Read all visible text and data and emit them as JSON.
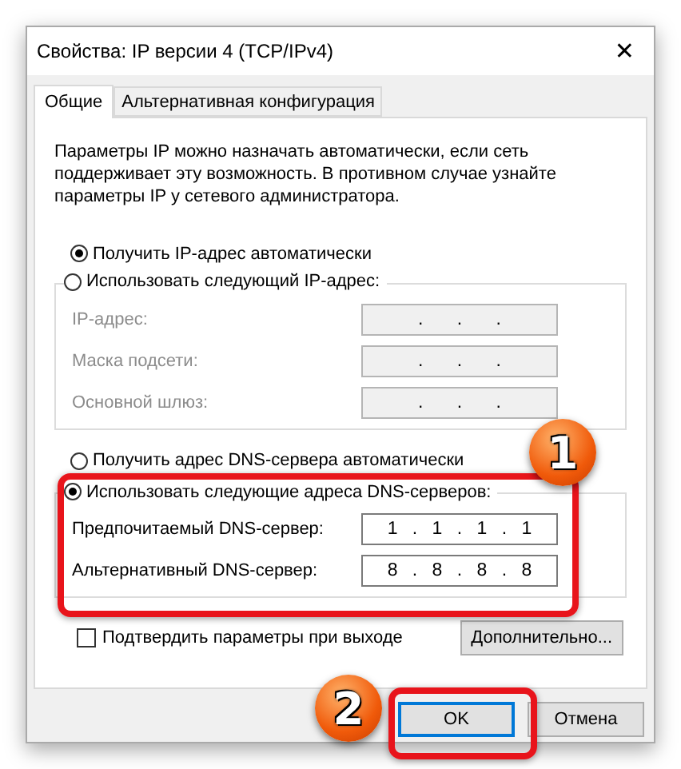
{
  "window": {
    "title": "Свойства: IP версии 4 (TCP/IPv4)",
    "close": "✕"
  },
  "tabs": [
    {
      "label": "Общие",
      "selected": true
    },
    {
      "label": "Альтернативная конфигурация",
      "selected": false
    }
  ],
  "description": "Параметры IP можно назначать автоматически, если сеть поддерживает эту возможность. В противном случае узнайте параметры IP у сетевого администратора.",
  "ip_mode": {
    "auto": {
      "label": "Получить IP-адрес автоматически",
      "selected": true
    },
    "manual": {
      "label": "Использовать следующий IP-адрес:",
      "selected": false,
      "fields": [
        {
          "label": "IP-адрес:",
          "value": ". . .",
          "disabled": true
        },
        {
          "label": "Маска подсети:",
          "value": ". . .",
          "disabled": true
        },
        {
          "label": "Основной шлюз:",
          "value": ". . .",
          "disabled": true
        }
      ]
    }
  },
  "dns_mode": {
    "auto": {
      "label": "Получить адрес DNS-сервера автоматически",
      "selected": false
    },
    "manual": {
      "label": "Использовать следующие адреса DNS-серверов:",
      "selected": true,
      "fields": [
        {
          "label": "Предпочитаемый DNS-сервер:",
          "value": "1 . 1 . 1 . 1",
          "disabled": false
        },
        {
          "label": "Альтернативный DNS-сервер:",
          "value": "8 . 8 . 8 . 8",
          "disabled": false
        }
      ]
    }
  },
  "validate_on_exit": {
    "label": "Подтвердить параметры при выходе",
    "checked": false
  },
  "advanced_button": "Дополнительно...",
  "buttons": [
    {
      "label": "OK",
      "default": true
    },
    {
      "label": "Отмена",
      "default": false
    }
  ],
  "callouts": [
    "1",
    "2"
  ]
}
